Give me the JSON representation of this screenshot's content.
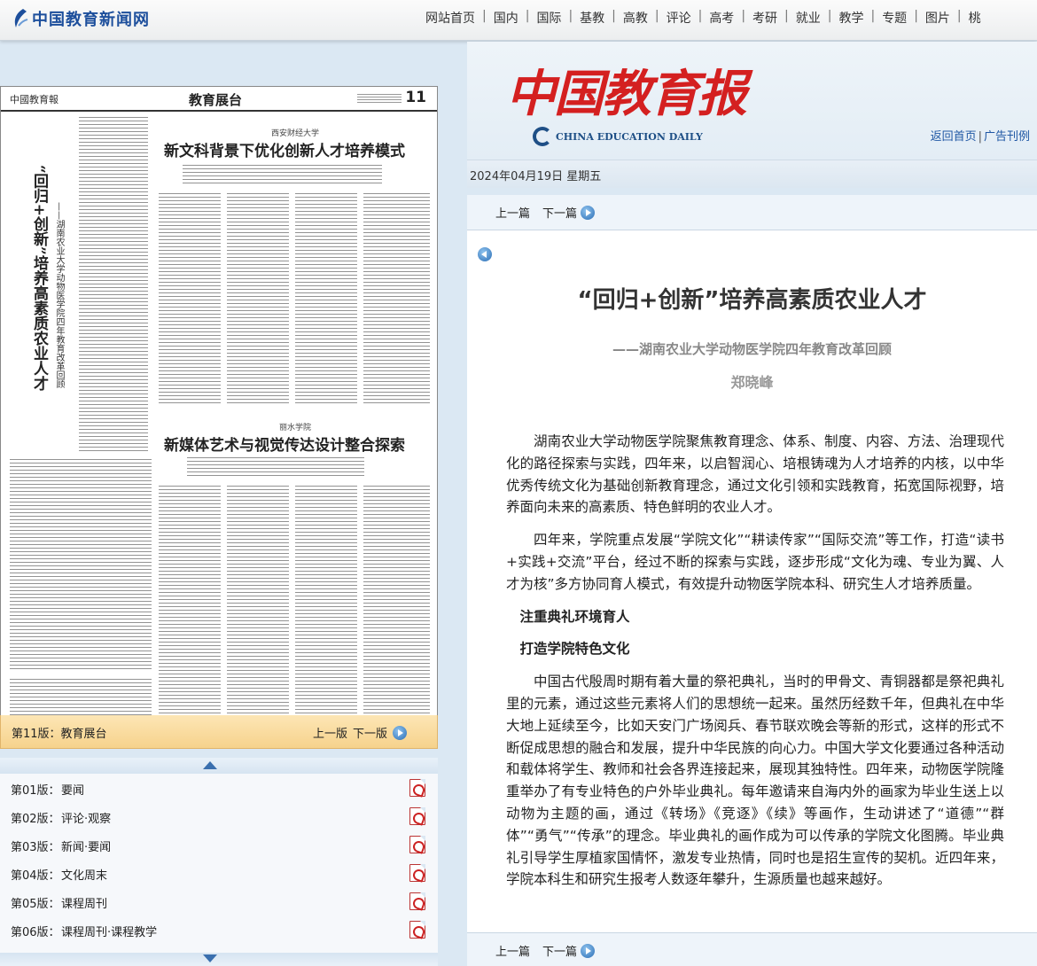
{
  "site": {
    "logo_text": "中国教育新闻网",
    "nav": [
      "网站首页",
      "国内",
      "国际",
      "基教",
      "高教",
      "评论",
      "高考",
      "考研",
      "就业",
      "教学",
      "专题",
      "图片",
      "桃"
    ]
  },
  "paper_preview": {
    "logo": "中國教育報",
    "section_title": "教育展台",
    "page_number": "11",
    "vertical_title": "“回归+创新”培养高素质农业人才",
    "vertical_subtitle": "——湖南农业大学动物医学院四年教育改革回顾",
    "article1_sub": "西安财经大学",
    "article1_title": "新文科背景下优化创新人才培养模式",
    "article2_sub": "丽水学院",
    "article2_title": "新媒体艺术与视觉传达设计整合探索"
  },
  "page_bar": {
    "label": "第11版：教育展台",
    "prev": "上一版",
    "next": "下一版"
  },
  "editions": [
    {
      "num": "第01版：",
      "name": "要闻"
    },
    {
      "num": "第02版：",
      "name": "评论·观察"
    },
    {
      "num": "第03版：",
      "name": "新闻·要闻"
    },
    {
      "num": "第04版：",
      "name": "文化周末"
    },
    {
      "num": "第05版：",
      "name": "课程周刊"
    },
    {
      "num": "第06版：",
      "name": "课程周刊·课程教学"
    }
  ],
  "masthead": {
    "logo": "中国教育报",
    "english": "CHINA EDUCATION DAILY",
    "link_home": "返回首页",
    "link_sep": "|",
    "link_ads": "广告刊例"
  },
  "date": "2024年04月19日 星期五",
  "article_nav": {
    "prev": "上一篇",
    "next": "下一篇"
  },
  "article": {
    "title": "“回归+创新”培养高素质农业人才",
    "subtitle": "——湖南农业大学动物医学院四年教育改革回顾",
    "author": "郑晓峰",
    "para1": "湖南农业大学动物医学院聚焦教育理念、体系、制度、内容、方法、治理现代化的路径探索与实践，四年来，以启智润心、培根铸魂为人才培养的内核，以中华优秀传统文化为基础创新教育理念，通过文化引领和实践教育，拓宽国际视野，培养面向未来的高素质、特色鲜明的农业人才。",
    "para2": "四年来，学院重点发展“学院文化”“耕读传家”“国际交流”等工作，打造“读书+实践+交流”平台，经过不断的探索与实践，逐步形成“文化为魂、专业为翼、人才为核”多方协同育人模式，有效提升动物医学院本科、研究生人才培养质量。",
    "heading1": "注重典礼环境育人",
    "heading2": "打造学院特色文化",
    "para3": "中国古代殷周时期有着大量的祭祀典礼，当时的甲骨文、青铜器都是祭祀典礼里的元素，通过这些元素将人们的思想统一起来。虽然历经数千年，但典礼在中华大地上延续至今，比如天安门广场阅兵、春节联欢晚会等新的形式，这样的形式不断促成思想的融合和发展，提升中华民族的向心力。中国大学文化要通过各种活动和载体将学生、教师和社会各界连接起来，展现其独特性。四年来，动物医学院隆重举办了有专业特色的户外毕业典礼。每年邀请来自海内外的画家为毕业生送上以动物为主题的画，通过《转场》《竞逐》《续》等画作，生动讲述了“道德”“群体”“勇气”“传承”的理念。毕业典礼的画作成为可以传承的学院文化图腾。毕业典礼引导学生厚植家国情怀，激发专业热情，同时也是招生宣传的契机。近四年来，学院本科生和研究生报考人数逐年攀升，生源质量也越来越好。"
  }
}
